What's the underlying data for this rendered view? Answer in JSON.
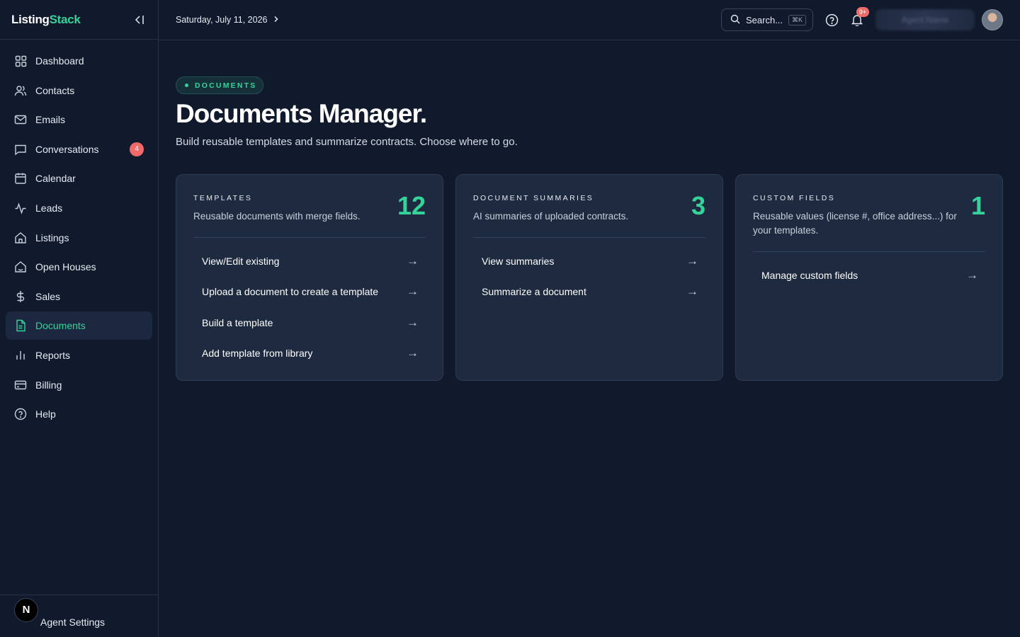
{
  "brand": {
    "part1": "Listing",
    "part2": "Stack"
  },
  "header": {
    "date": "Saturday, July 11, 2026",
    "search_label": "Search...",
    "search_shortcut": "⌘K",
    "notifications_badge": "9+",
    "user_name_blurred": "Agent Name"
  },
  "sidebar": {
    "items": [
      {
        "label": "Dashboard",
        "icon": "dashboard-icon"
      },
      {
        "label": "Contacts",
        "icon": "contacts-icon"
      },
      {
        "label": "Emails",
        "icon": "mail-icon"
      },
      {
        "label": "Conversations",
        "icon": "chat-icon",
        "badge": "4"
      },
      {
        "label": "Calendar",
        "icon": "calendar-icon"
      },
      {
        "label": "Leads",
        "icon": "activity-icon"
      },
      {
        "label": "Listings",
        "icon": "home-icon"
      },
      {
        "label": "Open Houses",
        "icon": "open-house-icon"
      },
      {
        "label": "Sales",
        "icon": "dollar-icon"
      },
      {
        "label": "Documents",
        "icon": "document-icon",
        "active": true
      },
      {
        "label": "Reports",
        "icon": "bar-chart-icon"
      },
      {
        "label": "Billing",
        "icon": "credit-card-icon"
      },
      {
        "label": "Help",
        "icon": "help-icon"
      }
    ],
    "footer": {
      "avatar_letter": "N",
      "label": "Agent Settings"
    }
  },
  "main": {
    "section_tag": "DOCUMENTS",
    "title": "Documents Manager.",
    "subtitle": "Build reusable templates and summarize contracts. Choose where to go.",
    "cards": [
      {
        "label": "TEMPLATES",
        "description": "Reusable documents with merge fields.",
        "count": "12",
        "links": [
          "View/Edit existing",
          "Upload a document to create a template",
          "Build a template",
          "Add template from library"
        ]
      },
      {
        "label": "DOCUMENT SUMMARIES",
        "description": "AI summaries of uploaded contracts.",
        "count": "3",
        "links": [
          "View summaries",
          "Summarize a document"
        ]
      },
      {
        "label": "CUSTOM FIELDS",
        "description": "Reusable values (license #, office address...) for your templates.",
        "count": "1",
        "links": [
          "Manage custom fields"
        ]
      }
    ],
    "arrow_glyph": "→"
  },
  "colors": {
    "background": "#111a2c",
    "card": "#1e2a3f",
    "accent": "#34d399",
    "badge": "#f06a6a"
  }
}
